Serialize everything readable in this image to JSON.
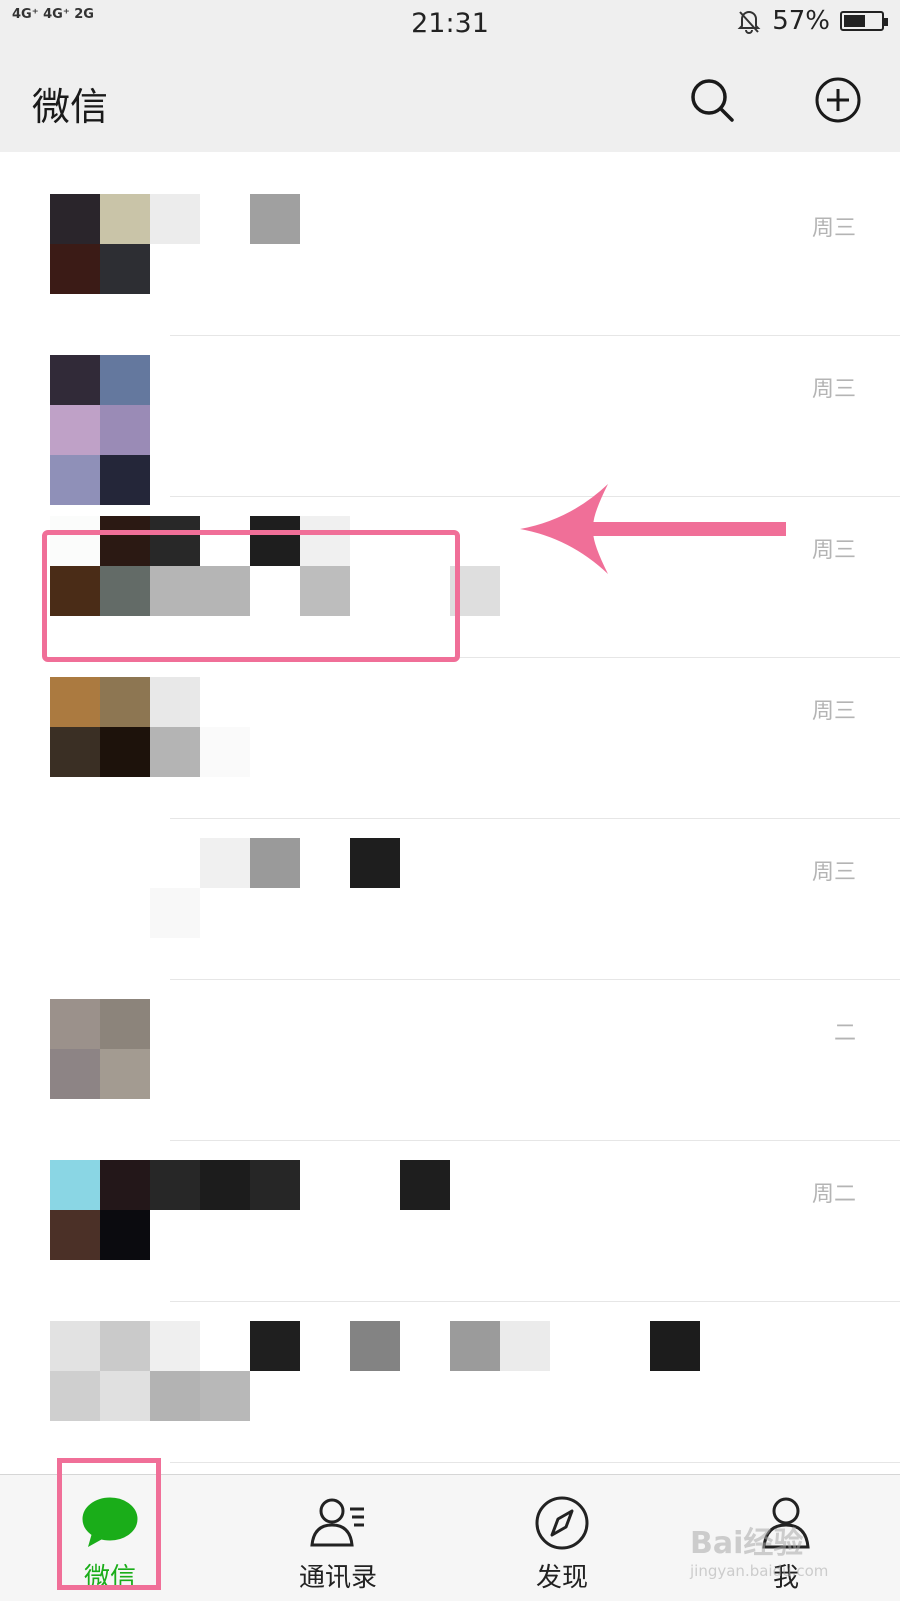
{
  "status_bar": {
    "network": "4G⁺ 4G⁺ 2G",
    "time": "21:31",
    "battery_percent": "57%",
    "battery_level": 0.57
  },
  "header": {
    "title": "微信",
    "search_icon": "search-icon",
    "add_icon": "plus-circle-icon"
  },
  "chats": [
    {
      "time": "周三",
      "tiles": [
        "#2a252b",
        "#c9c4a8",
        "#ececec",
        "",
        "#a0a0a0",
        "",
        "",
        "",
        "",
        "",
        "#3b1b16",
        "#2d2e33",
        "",
        "",
        "",
        "",
        "",
        "",
        "",
        ""
      ]
    },
    {
      "time": "周三",
      "tiles": [
        "#312a38",
        "#64789e",
        "",
        "",
        "",
        "",
        "",
        "",
        "",
        "",
        "#bfa1c7",
        "#9a8bb6",
        "",
        "",
        "",
        "",
        "",
        "",
        "",
        ""
      ],
      "extra_row": [
        "#8f90b8",
        "#242639"
      ]
    },
    {
      "time": "周三",
      "tiles": [
        "#fbfcfb",
        "#2b1913",
        "#282828",
        "",
        "#1e1e1e",
        "#f0f0f0",
        "",
        "",
        "",
        "",
        "#4a2c17",
        "#636b67",
        "#b5b5b5",
        "#b5b5b5",
        "",
        "#bdbdbd",
        "",
        "",
        "#dedede",
        ""
      ]
    },
    {
      "time": "周三",
      "tiles": [
        "#ab7a40",
        "#8d7652",
        "#e8e8e8",
        "",
        "",
        "",
        "",
        "",
        "",
        "",
        "#3a2f24",
        "#1d120b",
        "#b4b4b4",
        "#fafafa",
        "",
        "",
        "",
        "",
        "",
        ""
      ]
    },
    {
      "time": "周三",
      "tiles": [
        "",
        "",
        "",
        "#f0f0f0",
        "#9a9a9a",
        "",
        "#1e1e1e",
        "",
        "",
        "",
        "",
        "",
        "#f8f8f8",
        "",
        "",
        "",
        "",
        "",
        "",
        ""
      ],
      "shift_down": true
    },
    {
      "time": "二",
      "tiles": [
        "#9b918b",
        "#8c847b",
        "",
        "",
        "",
        "",
        "",
        "",
        "",
        "",
        "#8d8485",
        "#a39b91",
        "",
        "",
        "",
        "",
        "",
        "",
        "",
        ""
      ]
    },
    {
      "time": "周二",
      "tiles": [
        "#8ad6e4",
        "#231719",
        "#272727",
        "#1c1c1c",
        "#262626",
        "",
        "",
        "#1e1e1e",
        "",
        "",
        "#4b3027",
        "#0b0b0f",
        "",
        "",
        "",
        "",
        "",
        "",
        "",
        ""
      ]
    },
    {
      "time": "",
      "tiles": [
        "#e2e2e2",
        "#cacaca",
        "#efefef",
        "",
        "#1f1f1f",
        "",
        "#838383",
        "",
        "#9b9b9b",
        "#ebebeb",
        "#cfcfcf",
        "#e0e0e0",
        "#b3b3b3",
        "#b8b8b8",
        "",
        "",
        "",
        "",
        "",
        ""
      ],
      "extra_tile": [
        "#1c1c1c"
      ]
    }
  ],
  "tabs": [
    {
      "label": "微信",
      "icon": "chat-bubble-icon",
      "active": true
    },
    {
      "label": "通讯录",
      "icon": "contacts-icon",
      "active": false
    },
    {
      "label": "发现",
      "icon": "compass-icon",
      "active": false
    },
    {
      "label": "我",
      "icon": "person-icon",
      "active": false
    }
  ],
  "colors": {
    "accent_green": "#1aad19",
    "annotation_pink": "#f06f98",
    "header_bg": "#efefef"
  },
  "watermark": {
    "brand": "Bai经验",
    "url": "jingyan.baidu.com"
  }
}
